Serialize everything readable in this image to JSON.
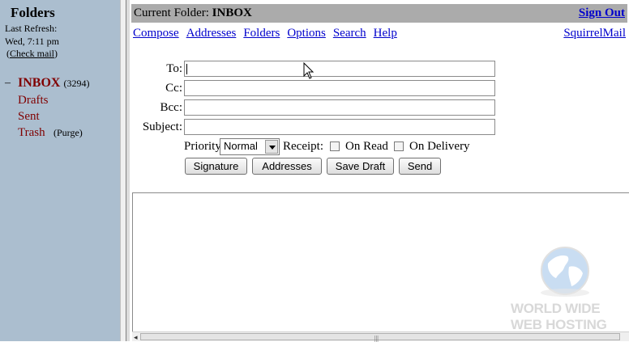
{
  "left_pane": {
    "title": "Folders",
    "last_refresh_label": "Last Refresh:",
    "last_refresh_time": "Wed, 7:11 pm",
    "check_mail": "Check mail",
    "collapse_symbol": "–",
    "folders": [
      {
        "name": "INBOX",
        "count": "(3294)"
      },
      {
        "name": "Drafts"
      },
      {
        "name": "Sent"
      },
      {
        "name": "Trash",
        "action": "(Purge)"
      }
    ]
  },
  "header": {
    "current_folder_label": "Current Folder:",
    "current_folder": "INBOX",
    "sign_out": "Sign Out"
  },
  "menu": {
    "items": [
      "Compose",
      "Addresses",
      "Folders",
      "Options",
      "Search",
      "Help"
    ],
    "brand_link": "SquirrelMail"
  },
  "compose": {
    "to_label": "To:",
    "cc_label": "Cc:",
    "bcc_label": "Bcc:",
    "subject_label": "Subject:",
    "to_value": "",
    "cc_value": "",
    "bcc_value": "",
    "subject_value": "",
    "priority_label": "Priority",
    "priority_value": "Normal",
    "receipt_label": "Receipt:",
    "on_read_label": "On Read",
    "on_read_checked": false,
    "on_delivery_label": "On Delivery",
    "on_delivery_checked": false,
    "buttons": {
      "signature": "Signature",
      "addresses": "Addresses",
      "save_draft": "Save Draft",
      "send": "Send"
    },
    "body_value": ""
  },
  "scrollbar": {
    "left_arrow": "◂",
    "grip": "|||"
  },
  "watermark": {
    "line1": "WORLD WIDE",
    "line2": "WEB HOSTING"
  },
  "colors": {
    "left_pane_bg": "#abbecf",
    "folder_color": "#800000",
    "link_color": "#0000cc",
    "header_bar_bg": "#ababab"
  }
}
